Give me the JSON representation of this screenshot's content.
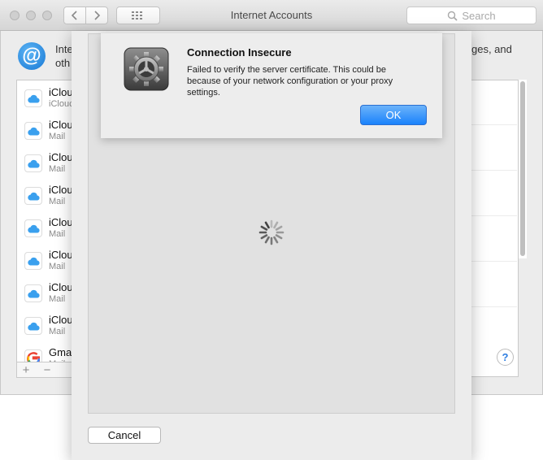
{
  "window": {
    "title": "Internet Accounts",
    "search_placeholder": "Search",
    "intro_line1": "Inte",
    "intro_line2": "oth",
    "intro_right": "ges, and",
    "help_label": "?"
  },
  "accounts": [
    {
      "name": "iClou",
      "sub": "iClouc",
      "icon": "icloud-icon"
    },
    {
      "name": "iClou",
      "sub": "Mail",
      "icon": "icloud-icon"
    },
    {
      "name": "iClou",
      "sub": "Mail",
      "icon": "icloud-icon"
    },
    {
      "name": "iClou",
      "sub": "Mail",
      "icon": "icloud-icon"
    },
    {
      "name": "iClou",
      "sub": "Mail",
      "icon": "icloud-icon"
    },
    {
      "name": "iClou",
      "sub": "Mail",
      "icon": "icloud-icon"
    },
    {
      "name": "iClou",
      "sub": "Mail",
      "icon": "icloud-icon"
    },
    {
      "name": "iClou",
      "sub": "Mail",
      "icon": "icloud-icon"
    },
    {
      "name": "Gmai",
      "sub": "Mail",
      "icon": "google-icon"
    }
  ],
  "list_footer": {
    "add_label": "+",
    "remove_label": "−"
  },
  "sheet": {
    "cancel_label": "Cancel"
  },
  "alert": {
    "title": "Connection Insecure",
    "message_lines": [
      "Failed to verify the server certificate. This could be",
      "because of your network configuration or your proxy",
      "settings."
    ],
    "ok_label": "OK"
  },
  "colors": {
    "accent_blue": "#1a82fb",
    "icloud_blue": "#3aa0ee",
    "window_bg": "#ececec"
  }
}
